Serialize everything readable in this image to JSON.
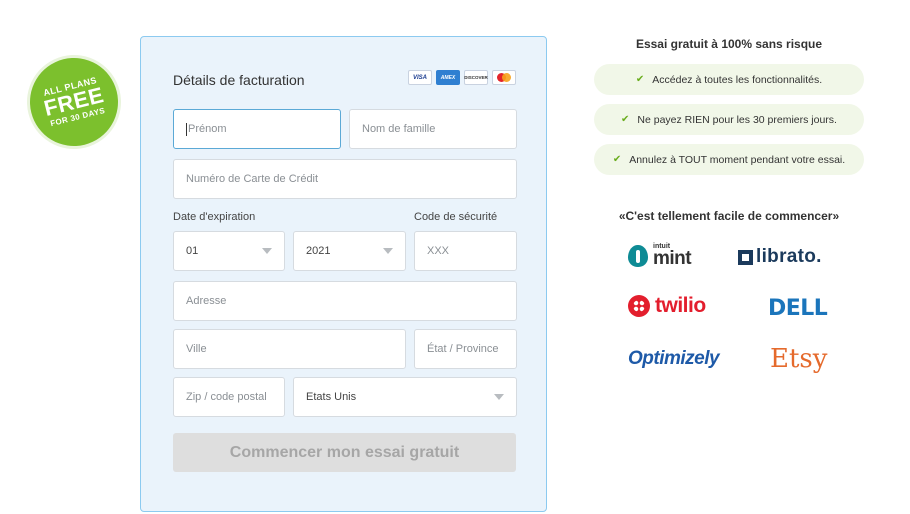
{
  "badge": {
    "line1": "ALL PLANS",
    "line2": "FREE",
    "line3": "FOR 30 DAYS"
  },
  "form": {
    "title": "Détails de facturation",
    "cards": [
      "VISA",
      "AMEX",
      "DISCOVER",
      "MasterCard"
    ],
    "first_name_placeholder": "Prénom",
    "last_name_placeholder": "Nom de famille",
    "card_number_placeholder": "Numéro de Carte de Crédit",
    "expiration_label": "Date d'expiration",
    "security_label": "Code de sécurité",
    "month_value": "01",
    "year_value": "2021",
    "cvv_placeholder": "XXX",
    "address_placeholder": "Adresse",
    "city_placeholder": "Ville",
    "state_placeholder": "État / Province",
    "zip_placeholder": "Zip / code postal",
    "country_value": "Etats Unis",
    "submit_label": "Commencer mon essai gratuit"
  },
  "benefits": {
    "title": "Essai gratuit à 100% sans risque",
    "items": [
      "Accédez à toutes les fonctionnalités.",
      "Ne payez RIEN pour les 30 premiers jours.",
      "Annulez à TOUT moment pendant votre essai."
    ]
  },
  "customers": {
    "title": "«C'est tellement facile de commencer»",
    "mint_small": "intuit",
    "mint": "mint",
    "librato": "librato.",
    "twilio": "twilio",
    "dell": "DELL",
    "optimizely": "Optimizely",
    "etsy": "Etsy"
  },
  "colors": {
    "accent_green": "#7cc02d",
    "panel_bg": "#eaf3fb",
    "panel_border": "#8ccaf0"
  }
}
